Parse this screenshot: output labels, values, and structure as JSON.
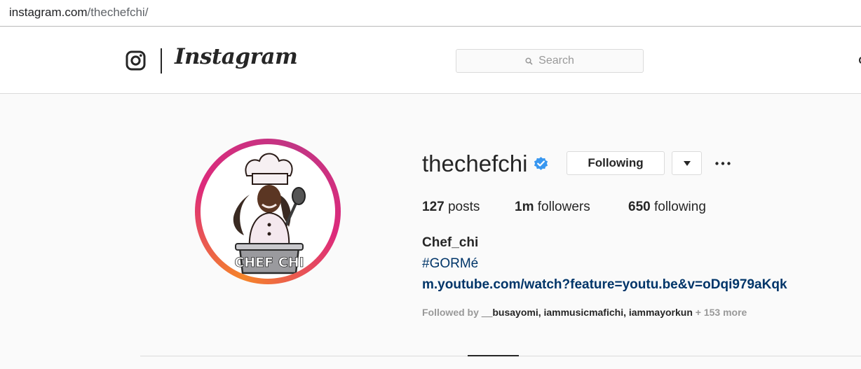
{
  "browser": {
    "url_host": "instagram.com",
    "url_path": "/thechefchi/"
  },
  "nav": {
    "wordmark": "Instagram",
    "search_placeholder": "Search"
  },
  "avatar": {
    "logo_text": "CHEF CHI"
  },
  "profile": {
    "username": "thechefchi",
    "following_button": "Following",
    "posts_count": "127",
    "posts_label": "posts",
    "followers_count": "1m",
    "followers_label": "followers",
    "following_count": "650",
    "following_label": "following",
    "full_name": "Chef_chi",
    "bio_hashtag": "#GORMé",
    "bio_link": "m.youtube.com/watch?feature=youtu.be&v=oDqi979aKqk",
    "followed_by_prefix": "Followed by ",
    "followed_by_names": "__busayomi, iammusicmafichi, iammayorkun",
    "followed_by_more": " + 153 more"
  },
  "colors": {
    "link": "#003569",
    "verified": "#3897f0",
    "muted": "#999999",
    "ring_start": "#f58529",
    "ring_end": "#c13584"
  },
  "icons": [
    "instagram-glyph-icon",
    "search-icon",
    "verified-badge-icon",
    "caret-down-icon",
    "more-options-icon"
  ]
}
